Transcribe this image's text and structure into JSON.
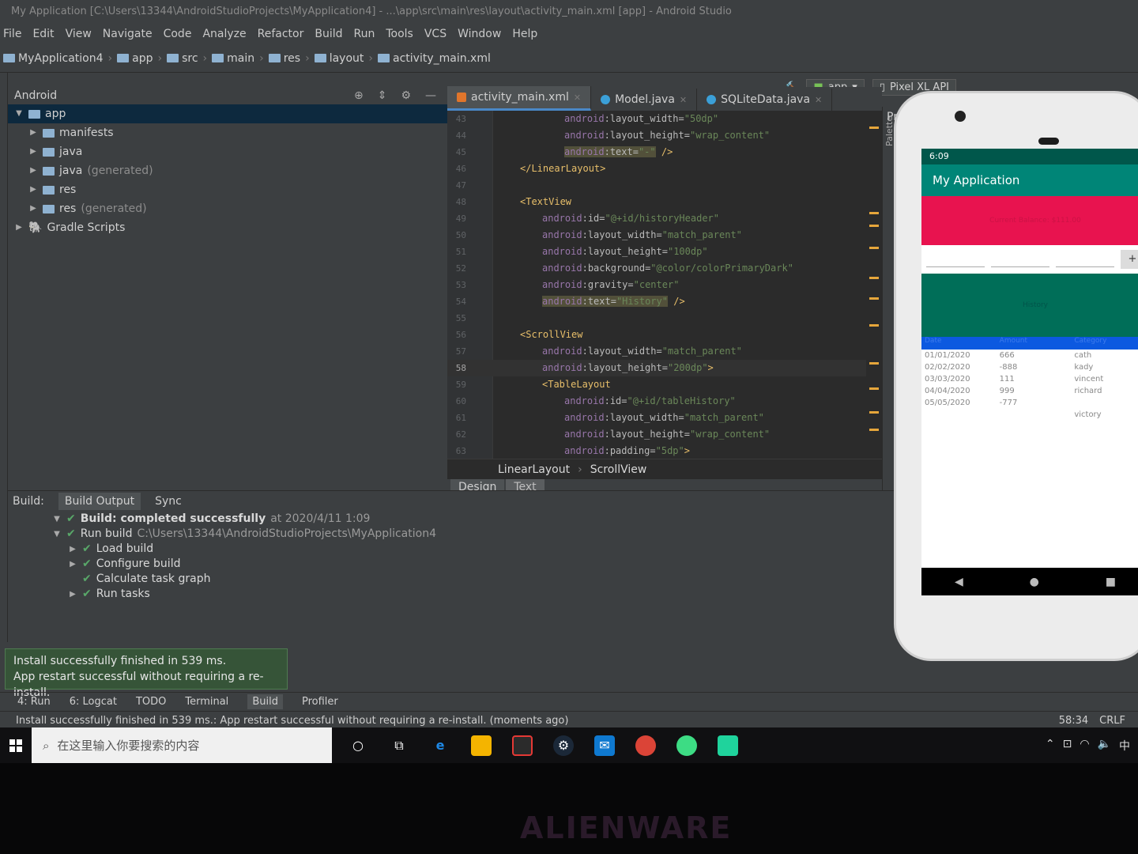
{
  "window": {
    "title": "My Application [C:\\Users\\13344\\AndroidStudioProjects\\MyApplication4] - ...\\app\\src\\main\\res\\layout\\activity_main.xml [app] - Android Studio"
  },
  "menu": [
    "File",
    "Edit",
    "View",
    "Navigate",
    "Code",
    "Analyze",
    "Refactor",
    "Build",
    "Run",
    "Tools",
    "VCS",
    "Window",
    "Help"
  ],
  "nav": {
    "project": "MyApplication4",
    "crumbs": [
      "app",
      "src",
      "main",
      "res",
      "layout",
      "activity_main.xml"
    ]
  },
  "toolbar": {
    "config": "app",
    "device": "Pixel XL API"
  },
  "project": {
    "view": "Android",
    "root": "app",
    "items": [
      {
        "label": "manifests",
        "suffix": ""
      },
      {
        "label": "java",
        "suffix": ""
      },
      {
        "label": "java",
        "suffix": "(generated)"
      },
      {
        "label": "res",
        "suffix": ""
      },
      {
        "label": "res",
        "suffix": "(generated)"
      }
    ],
    "gradle": "Gradle Scripts"
  },
  "editor": {
    "tabs": [
      "activity_main.xml",
      "Model.java",
      "SQLiteData.java"
    ],
    "lines": [
      {
        "n": "43",
        "html": "<span class='ns'>android</span>:<span class='attr'>layout_width</span>=<span class='val'>\"50dp\"</span>",
        "indent": 8
      },
      {
        "n": "44",
        "html": "<span class='ns'>android</span>:<span class='attr'>layout_height</span>=<span class='val'>\"wrap_content\"</span>",
        "indent": 8
      },
      {
        "n": "45",
        "html": "<span class='hl'><span class='ns'>android</span>:<span class='attr'>text</span>=<span class='val'>\"-\"</span></span> <span class='tag'>/&gt;</span>",
        "indent": 8
      },
      {
        "n": "46",
        "html": "<span class='tag'>&lt;/LinearLayout&gt;</span>",
        "indent": 0
      },
      {
        "n": "47",
        "html": "",
        "indent": 0
      },
      {
        "n": "48",
        "html": "<span class='tag'>&lt;TextView</span>",
        "indent": 0
      },
      {
        "n": "49",
        "html": "<span class='ns'>android</span>:<span class='attr'>id</span>=<span class='val'>\"@+id/historyHeader\"</span>",
        "indent": 4
      },
      {
        "n": "50",
        "html": "<span class='ns'>android</span>:<span class='attr'>layout_width</span>=<span class='val'>\"match_parent\"</span>",
        "indent": 4
      },
      {
        "n": "51",
        "html": "<span class='ns'>android</span>:<span class='attr'>layout_height</span>=<span class='val'>\"100dp\"</span>",
        "indent": 4
      },
      {
        "n": "52",
        "html": "<span class='ns'>android</span>:<span class='attr'>background</span>=<span class='val'>\"@color/colorPrimaryDark\"</span>",
        "indent": 4
      },
      {
        "n": "53",
        "html": "<span class='ns'>android</span>:<span class='attr'>gravity</span>=<span class='val'>\"center\"</span>",
        "indent": 4
      },
      {
        "n": "54",
        "html": "<span class='hl'><span class='ns'>android</span>:<span class='attr'>text</span>=<span class='val'>\"History\"</span></span> <span class='tag'>/&gt;</span>",
        "indent": 4
      },
      {
        "n": "55",
        "html": "",
        "indent": 0
      },
      {
        "n": "56",
        "html": "<span class='tag'>&lt;ScrollView</span>",
        "indent": 0
      },
      {
        "n": "57",
        "html": "<span class='ns'>android</span>:<span class='attr'>layout_width</span>=<span class='val'>\"match_parent\"</span>",
        "indent": 4
      },
      {
        "n": "58",
        "html": "<span class='ns'>android</span>:<span class='attr'>layout_height</span>=<span class='val'>\"200dp\"</span><span class='tag'>&gt;</span>",
        "indent": 4
      },
      {
        "n": "59",
        "html": "<span class='tag'>&lt;TableLayout</span>",
        "indent": 4
      },
      {
        "n": "60",
        "html": "<span class='ns'>android</span>:<span class='attr'>id</span>=<span class='val'>\"@+id/tableHistory\"</span>",
        "indent": 8
      },
      {
        "n": "61",
        "html": "<span class='ns'>android</span>:<span class='attr'>layout_width</span>=<span class='val'>\"match_parent\"</span>",
        "indent": 8
      },
      {
        "n": "62",
        "html": "<span class='ns'>android</span>:<span class='attr'>layout_height</span>=<span class='val'>\"wrap_content\"</span>",
        "indent": 8
      },
      {
        "n": "63",
        "html": "<span class='ns'>android</span>:<span class='attr'>padding</span>=<span class='val'>\"5dp\"</span><span class='tag'>&gt;</span>",
        "indent": 8
      }
    ],
    "current_line": "58",
    "breadcrumb": [
      "LinearLayout",
      "ScrollView"
    ],
    "mode_tabs": [
      "Design",
      "Text"
    ]
  },
  "preview": {
    "label": "Preview",
    "palette": "Palette"
  },
  "phone": {
    "time": "6:09",
    "app_title": "My Application",
    "balance_text": "Current Balance: $111.00",
    "plus": "+",
    "history_text": "History",
    "table_header": [
      "Date",
      "Amount",
      "Category"
    ],
    "rows": [
      [
        "01/01/2020",
        "666",
        "cath"
      ],
      [
        "02/02/2020",
        "-888",
        "kady"
      ],
      [
        "03/03/2020",
        "111",
        "vincent"
      ],
      [
        "04/04/2020",
        "999",
        "richard"
      ],
      [
        "05/05/2020",
        "-777",
        ""
      ],
      [
        "",
        "",
        "victory"
      ]
    ]
  },
  "build": {
    "tabs": [
      "Build:",
      "Build Output",
      "Sync"
    ],
    "result": "Build: completed successfully",
    "result_time": "at 2020/4/11 1:09",
    "run_label": "Run build",
    "run_path": "C:\\Users\\13344\\AndroidStudioProjects\\MyApplication4",
    "steps": [
      "Load build",
      "Configure build",
      "Calculate task graph",
      "Run tasks"
    ]
  },
  "toast": {
    "line1": "Install successfully finished in 539 ms.",
    "line2": "App restart successful without requiring a re-install."
  },
  "bottom_tools": [
    "4: Run",
    "6: Logcat",
    "TODO",
    "Terminal",
    "Build",
    "Profiler"
  ],
  "status": {
    "message": "Install successfully finished in 539 ms.: App restart successful without requiring a re-install. (moments ago)",
    "position": "58:34",
    "line_sep": "CRLF"
  },
  "taskbar": {
    "search_placeholder": "在这里输入你要搜索的内容",
    "ime": "中"
  },
  "brand": "ALIENWARE"
}
